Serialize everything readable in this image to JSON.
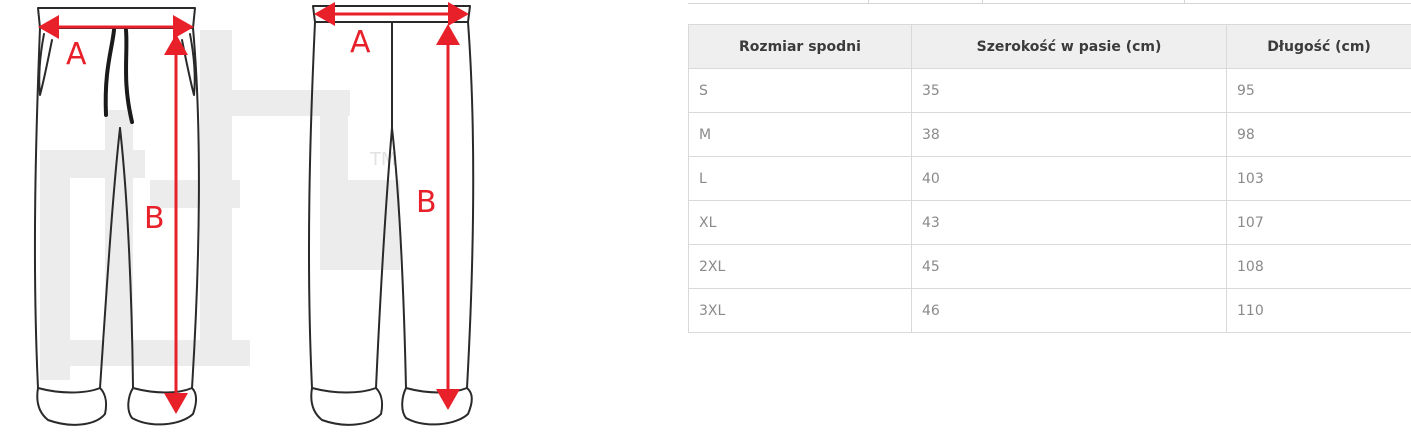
{
  "illustration": {
    "front_labels": {
      "a": "A",
      "b": "B"
    },
    "back_labels": {
      "a": "A",
      "b": "B"
    },
    "watermark_mark": "TM",
    "colors": {
      "arrow": "#e8202a",
      "outline": "#2a2a2a",
      "watermark": "#ececec"
    }
  },
  "size_table": {
    "headers": [
      "Rozmiar spodni",
      "Szerokość w pasie (cm)",
      "Długość (cm)"
    ],
    "rows": [
      [
        "S",
        "35",
        "95"
      ],
      [
        "M",
        "38",
        "98"
      ],
      [
        "L",
        "40",
        "103"
      ],
      [
        "XL",
        "43",
        "107"
      ],
      [
        "2XL",
        "45",
        "108"
      ],
      [
        "3XL",
        "46",
        "110"
      ]
    ]
  }
}
